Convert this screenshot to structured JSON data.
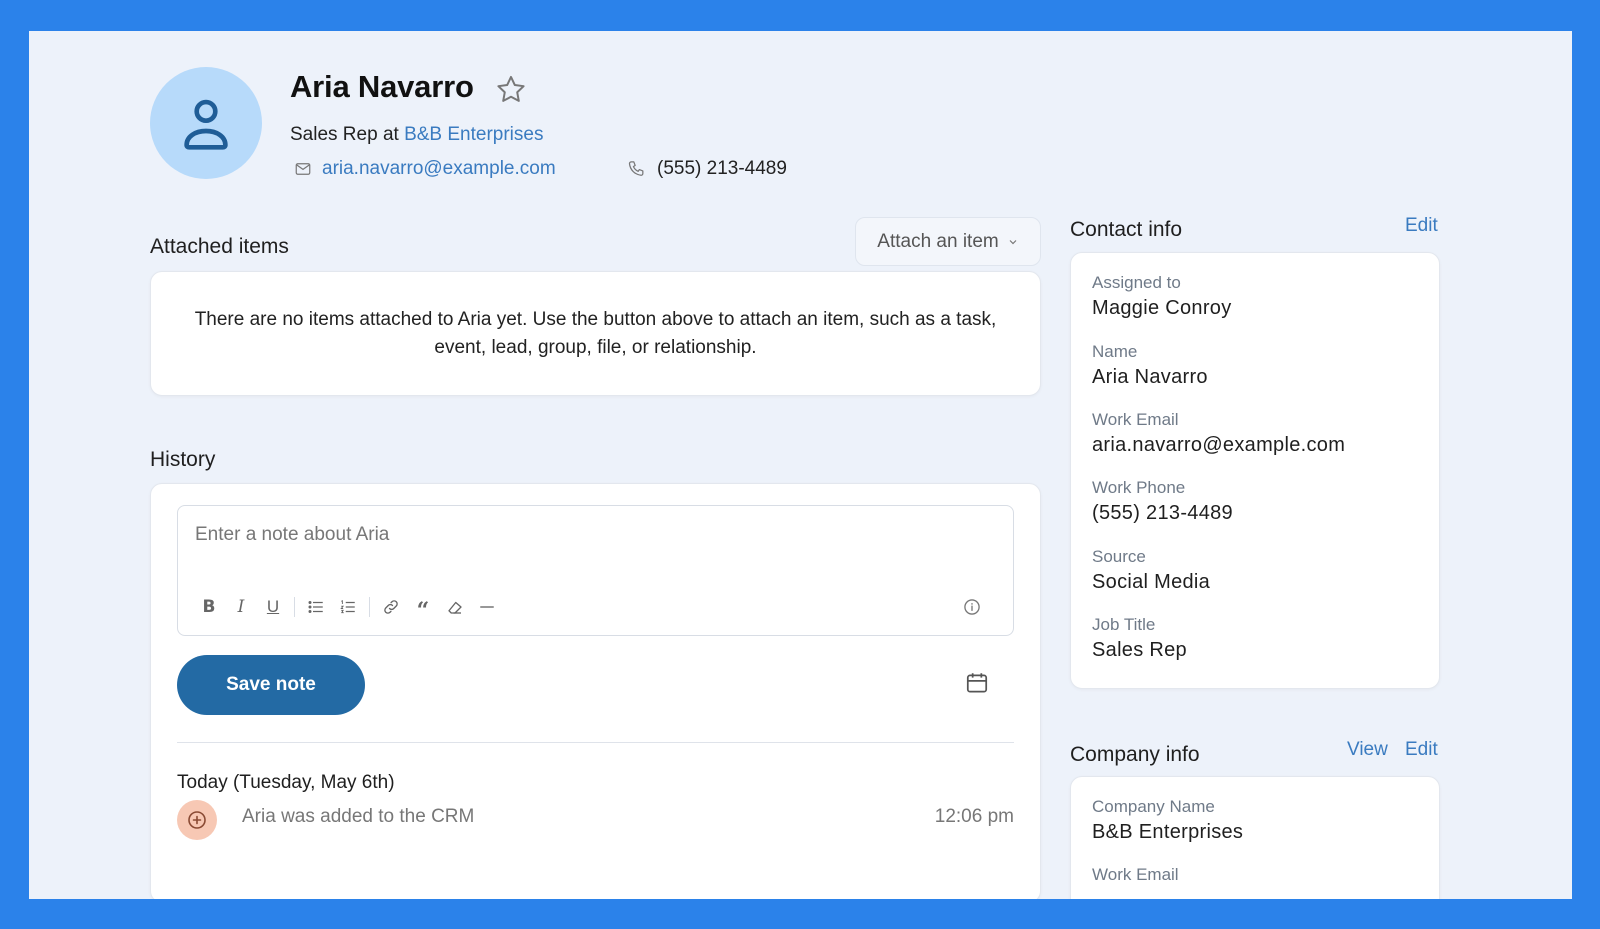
{
  "profile": {
    "name": "Aria Navarro",
    "role_prefix": "Sales Rep at",
    "company": "B&B Enterprises",
    "email": "aria.navarro@example.com",
    "phone": "(555) 213-4489"
  },
  "attached": {
    "title": "Attached items",
    "button_label": "Attach an item",
    "empty_message": "There are no items attached to Aria yet. Use the button above to attach an item, such as a task, event, lead, group, file, or relationship."
  },
  "history": {
    "title": "History",
    "note_placeholder": "Enter a note about Aria",
    "save_label": "Save note",
    "day_heading": "Today (Tuesday, May 6th)",
    "events": [
      {
        "text": "Aria was added to the CRM",
        "time": "12:06 pm"
      }
    ]
  },
  "contact_info": {
    "title": "Contact info",
    "edit_label": "Edit",
    "fields": [
      {
        "label": "Assigned to",
        "value": "Maggie Conroy"
      },
      {
        "label": "Name",
        "value": "Aria Navarro"
      },
      {
        "label": "Work Email",
        "value": "aria.navarro@example.com"
      },
      {
        "label": "Work Phone",
        "value": "(555) 213-4489"
      },
      {
        "label": "Source",
        "value": "Social Media"
      },
      {
        "label": "Job Title",
        "value": "Sales Rep"
      }
    ]
  },
  "company_info": {
    "title": "Company info",
    "view_label": "View",
    "edit_label": "Edit",
    "fields": [
      {
        "label": "Company Name",
        "value": "B&B Enterprises"
      },
      {
        "label": "Work Email",
        "value": ""
      }
    ]
  },
  "colors": {
    "outer_background": "#2b82ea",
    "page_background": "#edf2fa",
    "accent_link": "#3a7bc0",
    "primary_button": "#236aa4",
    "avatar_bg": "#b7dafa",
    "event_icon_bg": "#f7c8b4"
  },
  "icons": [
    "user-icon",
    "star-icon",
    "mail-icon",
    "phone-icon",
    "chevron-down-icon",
    "bold-icon",
    "italic-icon",
    "underline-icon",
    "bullet-list-icon",
    "numbered-list-icon",
    "link-icon",
    "quote-icon",
    "clear-format-icon",
    "horizontal-rule-icon",
    "info-icon",
    "calendar-icon",
    "plus-circle-icon"
  ]
}
